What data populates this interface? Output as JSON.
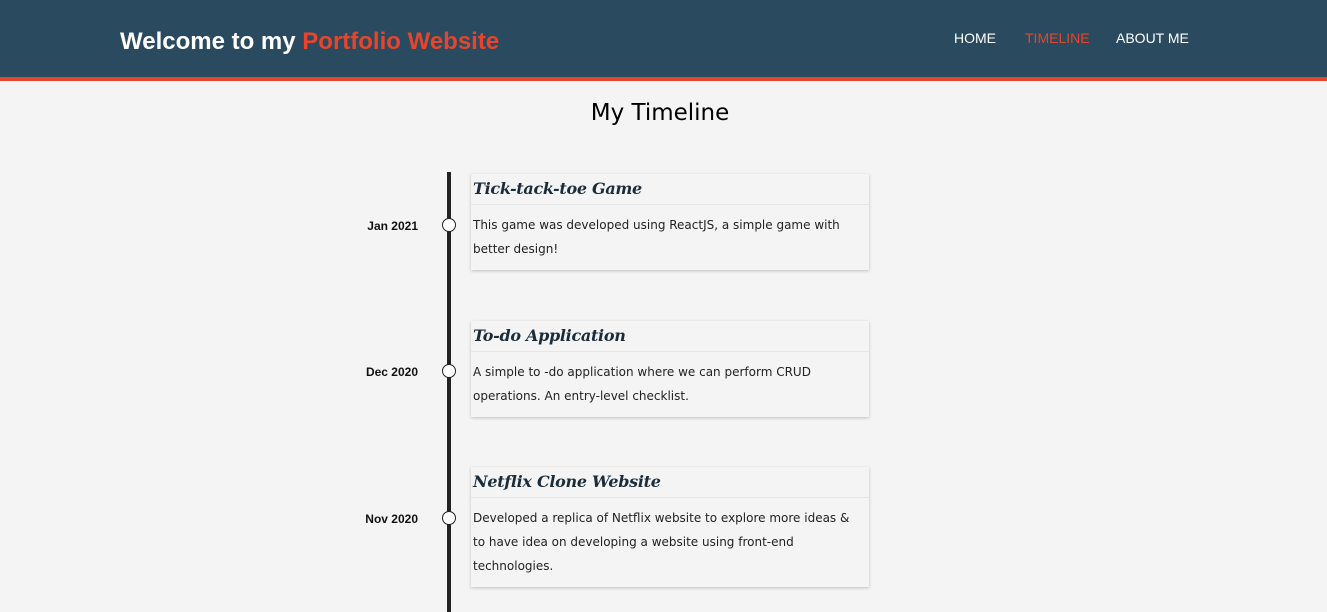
{
  "header": {
    "brand_prefix": "Welcome to my",
    "brand_accent": "Portfolio Website",
    "nav": [
      {
        "label": "HOME",
        "active": false
      },
      {
        "label": "TIMELINE",
        "active": true
      },
      {
        "label": "ABOUT ME",
        "active": false
      }
    ]
  },
  "page": {
    "title": "My Timeline"
  },
  "timeline": [
    {
      "date": "Jan 2021",
      "title": "Tick-tack-toe Game",
      "description": "This game was developed using ReactJS, a simple game with better design!"
    },
    {
      "date": "Dec 2020",
      "title": "To-do Application",
      "description": "A simple to -do application where we can perform CRUD operations. An entry-level checklist."
    },
    {
      "date": "Nov 2020",
      "title": "Netflix Clone Website",
      "description": "Developed a replica of Netflix website to explore more ideas & to have idea on developing a website using front-end technologies."
    }
  ],
  "colors": {
    "header_bg": "#2a4b5f",
    "accent": "#e4452c",
    "page_bg": "#f4f4f4"
  }
}
